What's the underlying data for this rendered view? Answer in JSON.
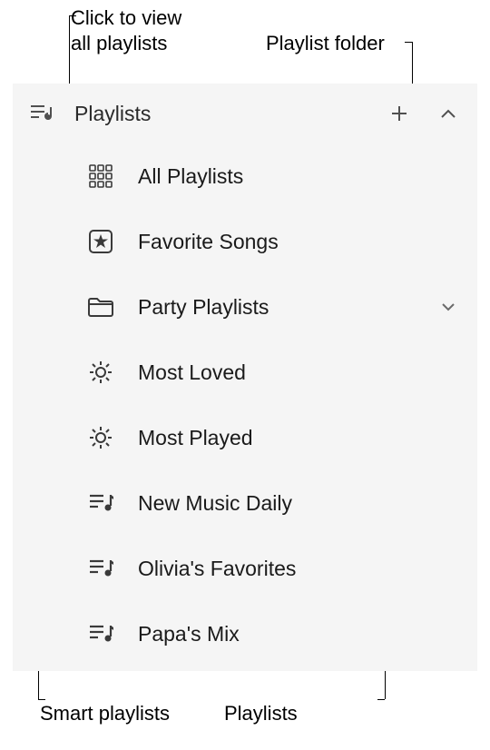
{
  "callouts": {
    "top_left_line1": "Click to view",
    "top_left_line2": "all playlists",
    "top_right": "Playlist folder",
    "bottom_left": "Smart playlists",
    "bottom_right": "Playlists"
  },
  "sidebar": {
    "header": {
      "title": "Playlists"
    },
    "items": {
      "all_playlists": "All Playlists",
      "favorite_songs": "Favorite Songs",
      "party_playlists": "Party Playlists",
      "most_loved": "Most Loved",
      "most_played": "Most Played",
      "new_music_daily": "New Music Daily",
      "olivias_favorites": "Olivia's Favorites",
      "papas_mix": "Papa's Mix"
    }
  }
}
